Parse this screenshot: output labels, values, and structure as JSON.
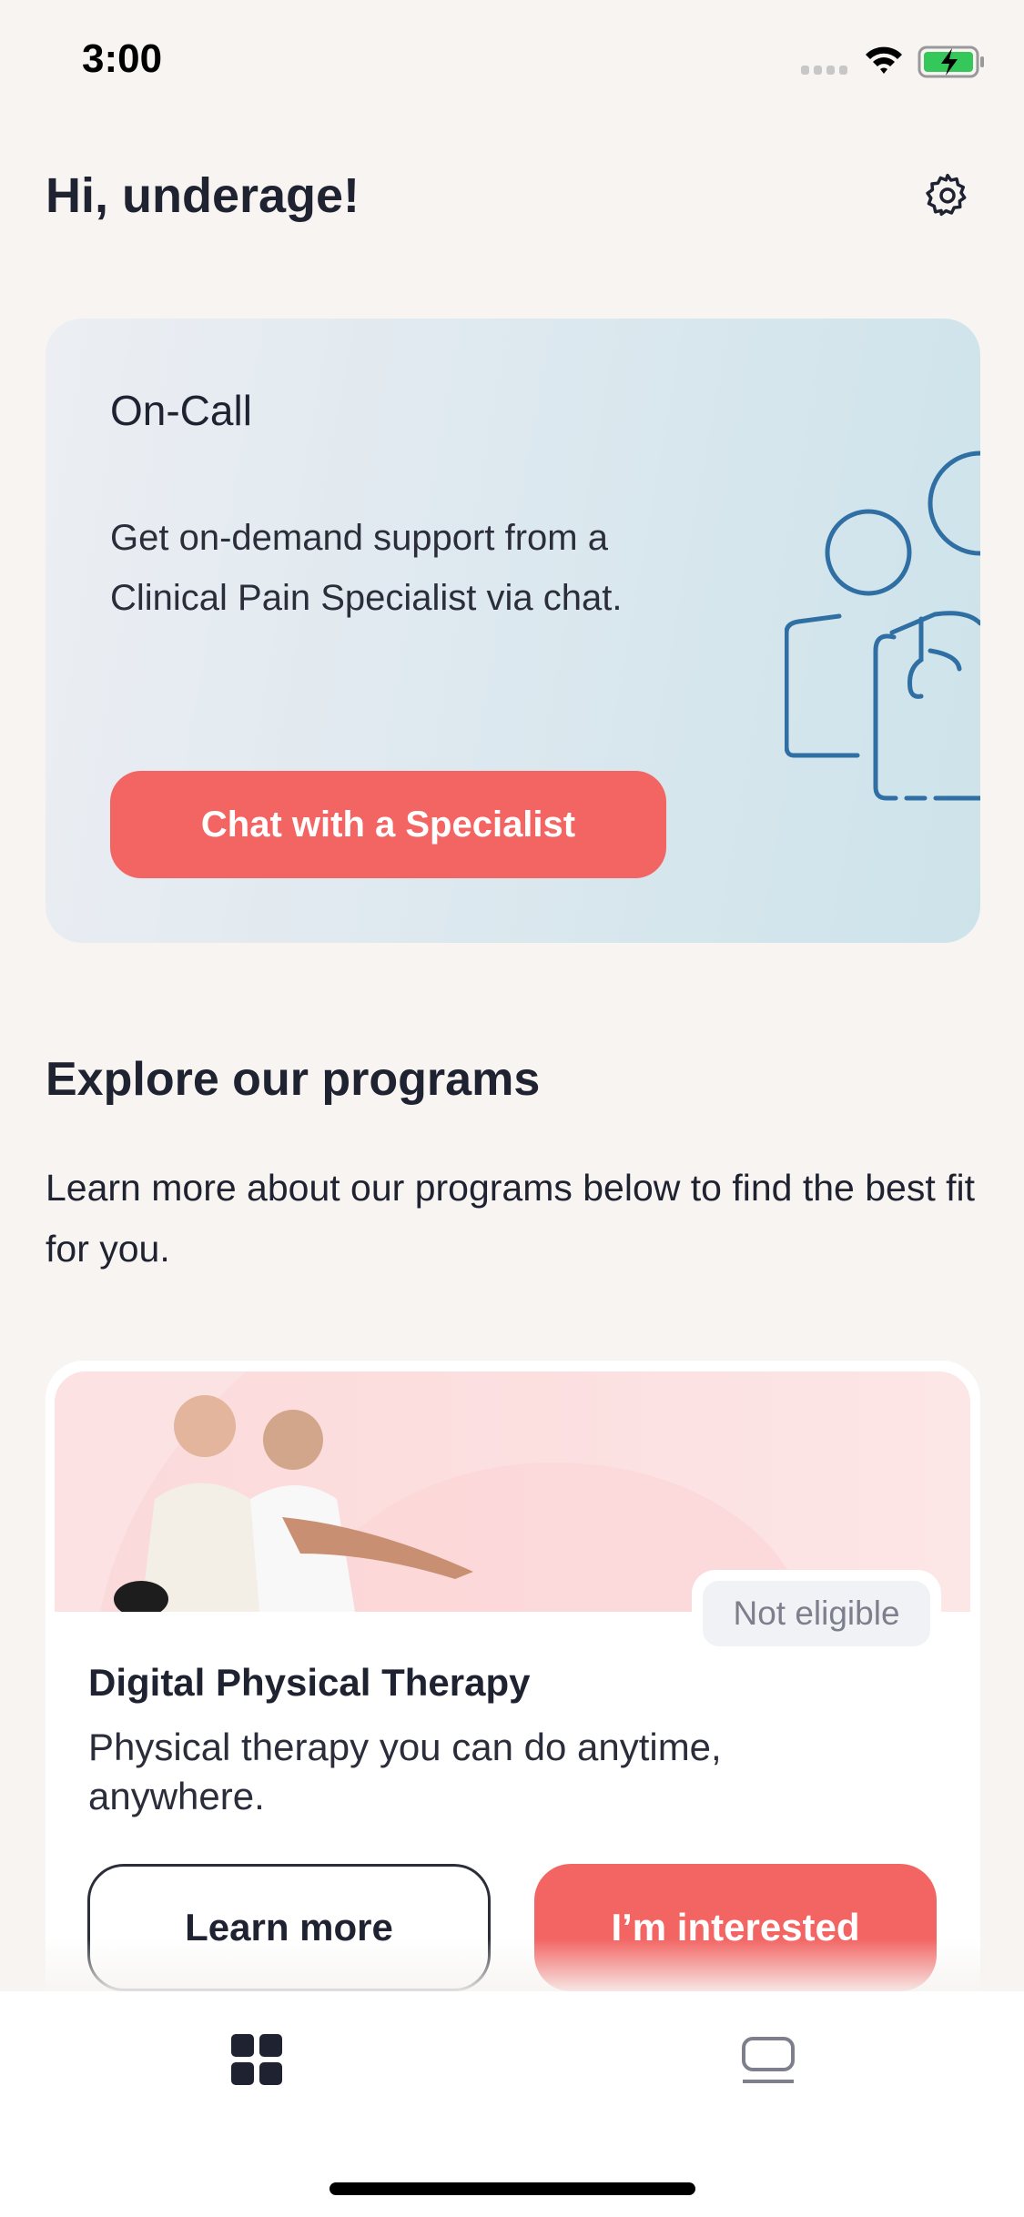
{
  "status_bar": {
    "time": "3:00"
  },
  "header": {
    "greeting": "Hi, underage!"
  },
  "on_call": {
    "title": "On-Call",
    "description": "Get on-demand support from a Clinical Pain Specialist via chat.",
    "button": "Chat with a Specialist"
  },
  "explore": {
    "title": "Explore our programs",
    "description": "Learn more about our programs below to find the best fit for you."
  },
  "program": {
    "badge": "Not eligible",
    "title": "Digital Physical Therapy",
    "description": "Physical therapy you can do anytime, anywhere.",
    "learn_more": "Learn more",
    "interested": "I’m interested"
  },
  "colors": {
    "accent": "#f26563",
    "background": "#f7f4f2",
    "illustration": "#2f6fa3"
  }
}
